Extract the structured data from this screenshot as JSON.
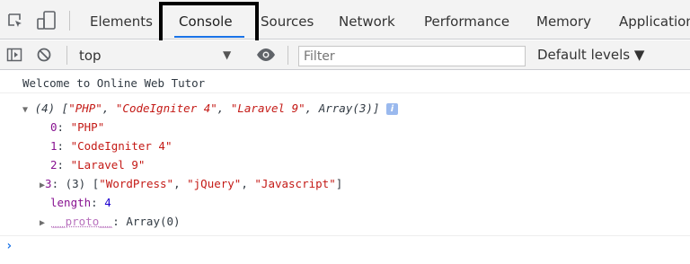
{
  "tabbar": {
    "inspect_icon": "element-picker-icon",
    "device_icon": "device-toggle-icon",
    "tabs": [
      {
        "label": "Elements"
      },
      {
        "label": "Console"
      },
      {
        "label": "Sources"
      },
      {
        "label": "Network"
      },
      {
        "label": "Performance"
      },
      {
        "label": "Memory"
      },
      {
        "label": "Application"
      }
    ],
    "active_tab": "Console",
    "highlight_color": "#000000",
    "accent_color": "#1a73e8"
  },
  "toolbar": {
    "sidebar_icon": "sidebar-toggle-icon",
    "clear_icon": "clear-console-icon",
    "context": "top",
    "eye_icon": "live-expression-icon",
    "filter_placeholder": "Filter",
    "levels_label": "Default levels ▼"
  },
  "console": {
    "log_message": "Welcome to Online Web Tutor",
    "array_summary": {
      "count": "(4)",
      "open": "[",
      "items": [
        "\"PHP\"",
        "\"CodeIgniter 4\"",
        "\"Laravel 9\"",
        "Array(3)"
      ],
      "close": "]",
      "info_badge": "i"
    },
    "entries": [
      {
        "key": "0",
        "value": "\"PHP\""
      },
      {
        "key": "1",
        "value": "\"CodeIgniter 4\""
      },
      {
        "key": "2",
        "value": "\"Laravel 9\""
      }
    ],
    "nested": {
      "key": "3",
      "count": "(3)",
      "open": "[",
      "items": [
        "\"WordPress\"",
        "\"jQuery\"",
        "\"Javascript\""
      ],
      "close": "]"
    },
    "length": {
      "key": "length",
      "value": "4"
    },
    "proto": {
      "key": "__proto__",
      "value": "Array(0)"
    },
    "prompt_symbol": "›"
  }
}
